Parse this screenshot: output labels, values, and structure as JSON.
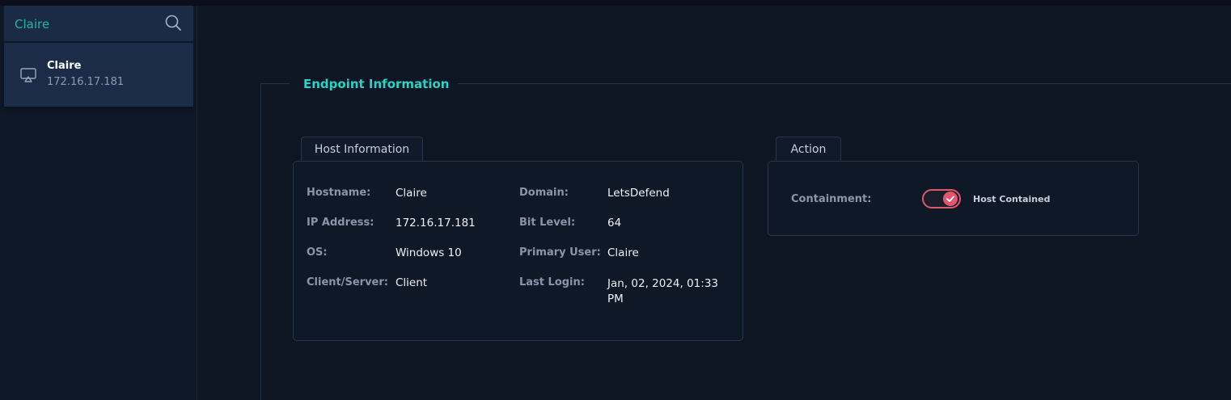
{
  "search": {
    "value": "Claire"
  },
  "host_list": [
    {
      "name": "Claire",
      "ip": "172.16.17.181"
    }
  ],
  "section_title": "Endpoint Information",
  "host_information": {
    "tab_label": "Host Information",
    "left_fields": [
      {
        "label": "Hostname:",
        "value": "Claire"
      },
      {
        "label": "IP Address:",
        "value": "172.16.17.181"
      },
      {
        "label": "OS:",
        "value": "Windows 10"
      },
      {
        "label": "Client/Server:",
        "value": "Client"
      }
    ],
    "right_fields": [
      {
        "label": "Domain:",
        "value": "LetsDefend"
      },
      {
        "label": "Bit Level:",
        "value": "64"
      },
      {
        "label": "Primary User:",
        "value": "Claire"
      },
      {
        "label": "Last Login:",
        "value": "Jan, 02, 2024, 01:33 PM"
      }
    ]
  },
  "action": {
    "tab_label": "Action",
    "containment_label": "Containment:",
    "toggle_on": true,
    "toggle_text": "Host Contained"
  },
  "colors": {
    "accent": "#27d3c7",
    "toggle": "#e5566b",
    "background": "#0e1624"
  }
}
